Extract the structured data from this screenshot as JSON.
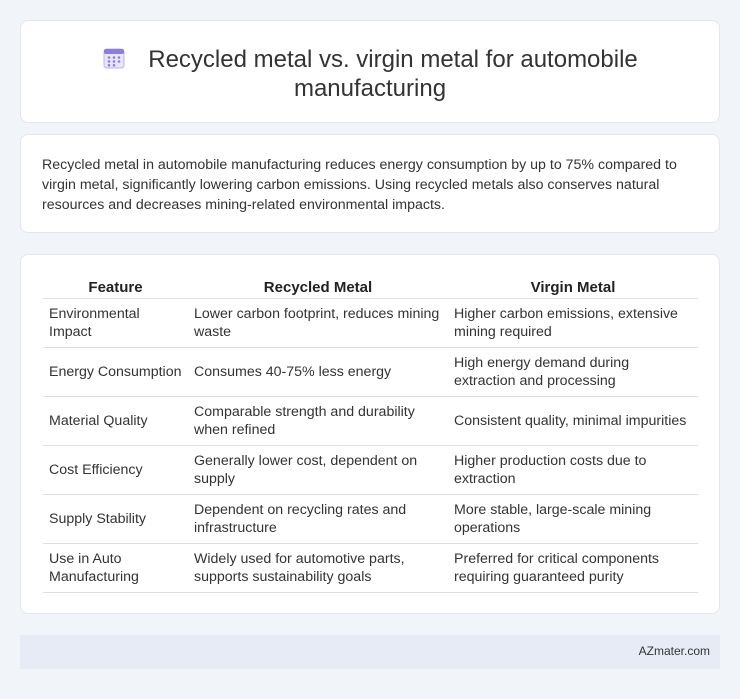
{
  "header": {
    "icon": "calendar-grid-icon",
    "title": "Recycled metal vs. virgin metal for automobile manufacturing"
  },
  "intro": {
    "text": "Recycled metal in automobile manufacturing reduces energy consumption by up to 75% compared to virgin metal, significantly lowering carbon emissions. Using recycled metals also conserves natural resources and decreases mining-related environmental impacts."
  },
  "table": {
    "headers": [
      "Feature",
      "Recycled Metal",
      "Virgin Metal"
    ],
    "rows": [
      [
        "Environmental Impact",
        "Lower carbon footprint, reduces mining waste",
        "Higher carbon emissions, extensive mining required"
      ],
      [
        "Energy Consumption",
        "Consumes 40-75% less energy",
        "High energy demand during extraction and processing"
      ],
      [
        "Material Quality",
        "Comparable strength and durability when refined",
        "Consistent quality, minimal impurities"
      ],
      [
        "Cost Efficiency",
        "Generally lower cost, dependent on supply",
        "Higher production costs due to extraction"
      ],
      [
        "Supply Stability",
        "Dependent on recycling rates and infrastructure",
        "More stable, large-scale mining operations"
      ],
      [
        "Use in Auto Manufacturing",
        "Widely used for automotive parts, supports sustainability goals",
        "Preferred for critical components requiring guaranteed purity"
      ]
    ]
  },
  "footer": {
    "site": "AZmater.com"
  },
  "colors": {
    "page_bg": "#f1f4f9",
    "card_bg": "#ffffff",
    "footer_bg": "#e6ebf6",
    "icon_accent": "#8b7fd6"
  }
}
